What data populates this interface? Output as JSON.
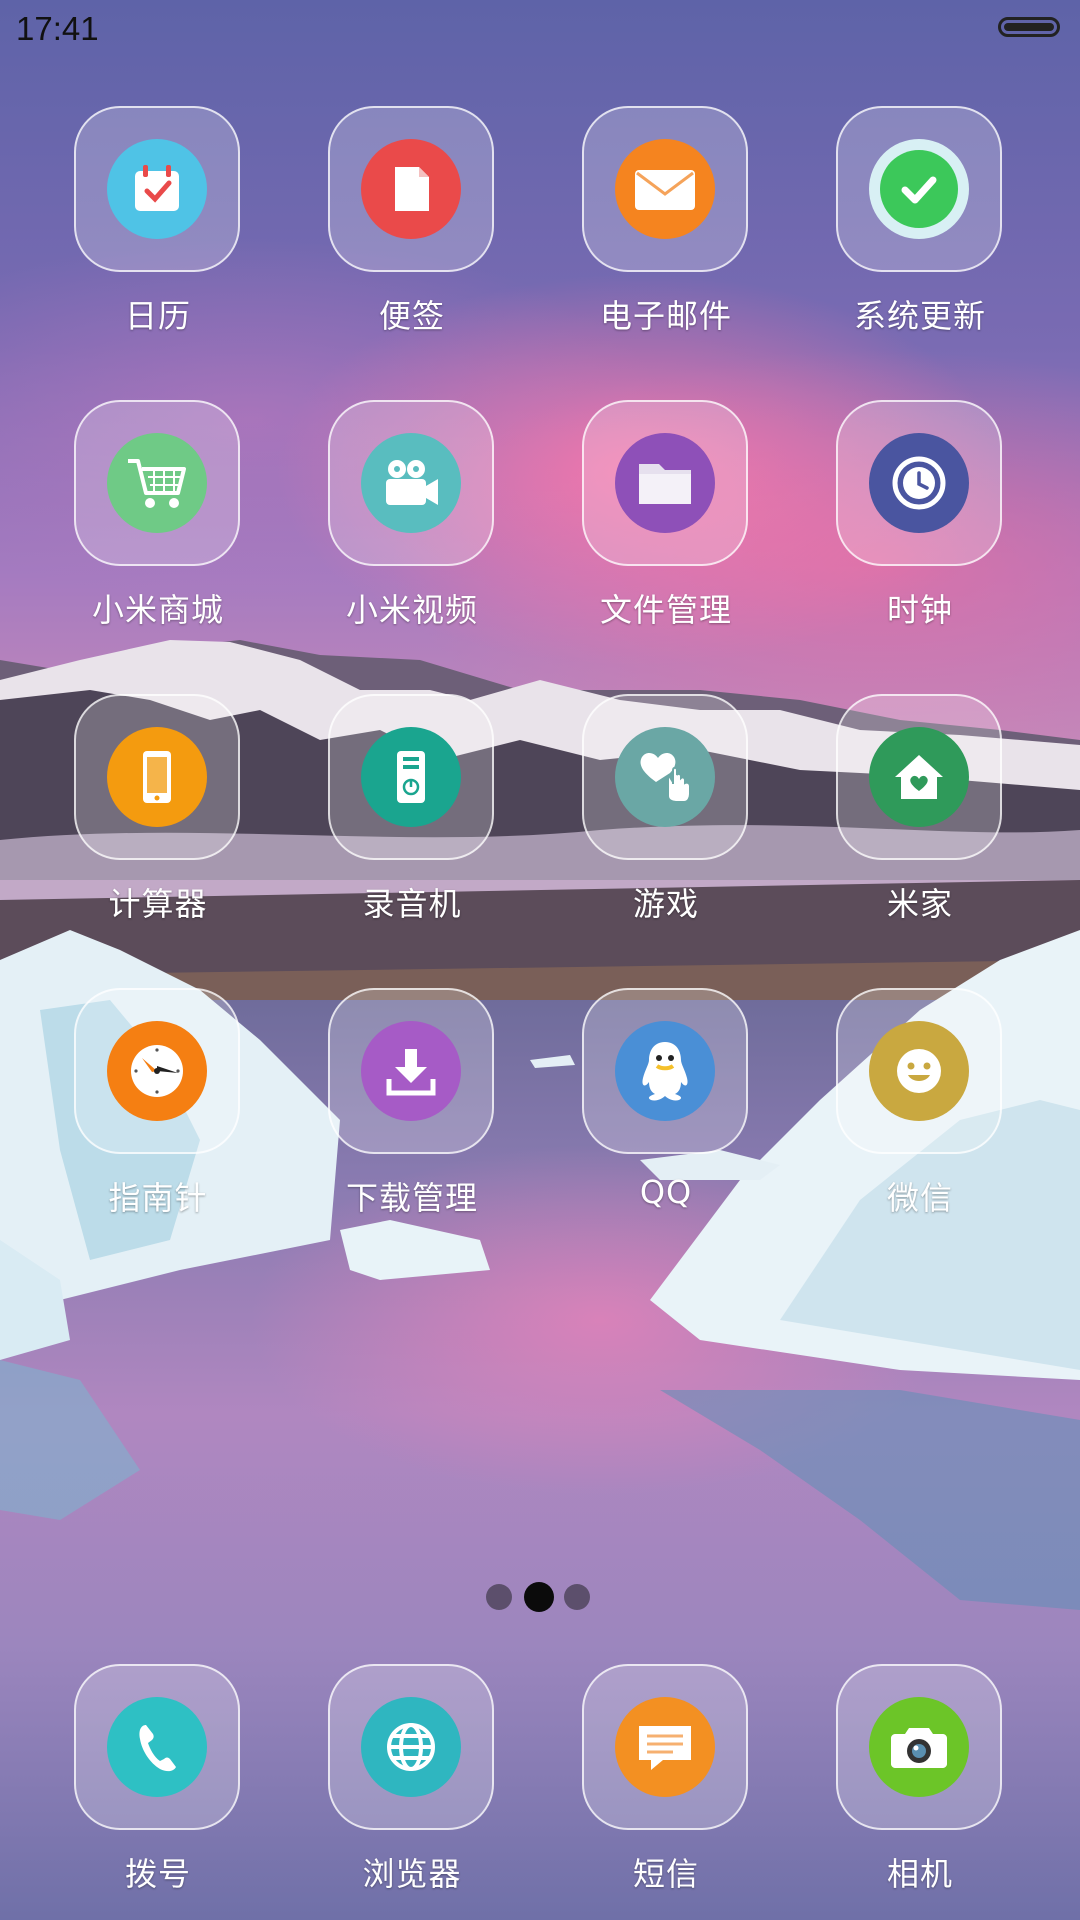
{
  "status_bar": {
    "time": "17:41"
  },
  "page_indicator": {
    "pages": 3,
    "active": 2
  },
  "apps": [
    {
      "label": "日历",
      "icon": "calendar-icon",
      "color": "#4fc3e6"
    },
    {
      "label": "便签",
      "icon": "note-icon",
      "color": "#ea4a4a"
    },
    {
      "label": "电子邮件",
      "icon": "mail-icon",
      "color": "#f5841f"
    },
    {
      "label": "系统更新",
      "icon": "update-check-icon",
      "color": "#3cc85a"
    },
    {
      "label": "小米商城",
      "icon": "cart-icon",
      "color": "#6fca86"
    },
    {
      "label": "小米视频",
      "icon": "video-camera-icon",
      "color": "#59bdbf"
    },
    {
      "label": "文件管理",
      "icon": "folder-icon",
      "color": "#8e50b8"
    },
    {
      "label": "时钟",
      "icon": "clock-icon",
      "color": "#4a55a0"
    },
    {
      "label": "计算器",
      "icon": "phone-calc-icon",
      "color": "#f49b0f"
    },
    {
      "label": "录音机",
      "icon": "recorder-icon",
      "color": "#1aa58f"
    },
    {
      "label": "游戏",
      "icon": "game-heart-icon",
      "color": "#6aa7a5"
    },
    {
      "label": "米家",
      "icon": "home-heart-icon",
      "color": "#2f9a5a"
    },
    {
      "label": "指南针",
      "icon": "compass-icon",
      "color": "#f57f12"
    },
    {
      "label": "下载管理",
      "icon": "download-icon",
      "color": "#a65bc6"
    },
    {
      "label": "QQ",
      "icon": "qq-penguin-icon",
      "color": "#4a8fd6"
    },
    {
      "label": "微信",
      "icon": "smile-icon",
      "color": "#c9a840"
    }
  ],
  "dock": [
    {
      "label": "拨号",
      "icon": "phone-icon",
      "color": "#2ec0c4"
    },
    {
      "label": "浏览器",
      "icon": "globe-icon",
      "color": "#2fb6c0"
    },
    {
      "label": "短信",
      "icon": "message-icon",
      "color": "#f39022"
    },
    {
      "label": "相机",
      "icon": "camera-icon",
      "color": "#6cc528"
    }
  ]
}
